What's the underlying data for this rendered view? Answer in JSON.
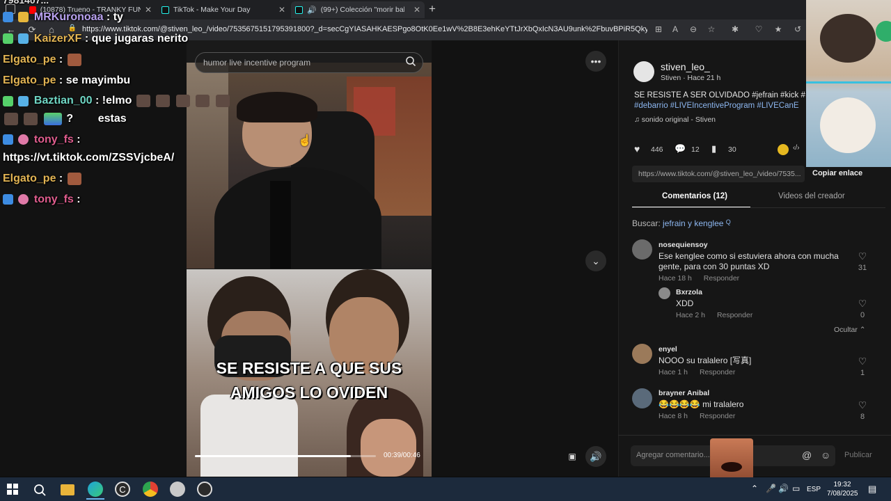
{
  "tabs": [
    {
      "label": "(10878) Trueno - TRANKY FUNKY",
      "favicon_color": "#ff0000"
    },
    {
      "label": "TikTok - Make Your Day",
      "favicon_color": "#25f4ee"
    },
    {
      "label": "(99+) Colección \"morir bale...",
      "favicon_color": "#25f4ee"
    }
  ],
  "new_tab_label": "+",
  "browser": {
    "url": "https://www.tiktok.com/@stiven_leo_/video/7535675151795391800?_d=secCgYIASAHKAESPgo8OtK0Ee1wV%2B8E3ehKeYTtJrXbQxIcN3AU9unk%2FbuvBPiR5Qky..."
  },
  "chat": {
    "top_fragment": "7981407...",
    "messages": [
      {
        "user": "MRKuronoaa",
        "text": ": ty",
        "user_color": "#b9a2f0"
      },
      {
        "user": "KaizerXF",
        "text": ": que jugaras nerito",
        "user_color": "#e2b453"
      },
      {
        "user": "Elgato_pe",
        "text": ":",
        "user_color": "#e2b453"
      },
      {
        "user": "Elgato_pe",
        "text": ": se mayimbu",
        "user_color": "#e2b453"
      },
      {
        "user": "Baztian_00",
        "text": ": !elmo",
        "user_color": "#6fd6c4"
      },
      {
        "user": "",
        "text": "?        estas",
        "user_color": "#ffffff"
      },
      {
        "user": "tony_fs",
        "text": ":",
        "user_color": "#e05d8e"
      },
      {
        "user": "",
        "text": "https://vt.tiktok.com/ZSSVjcbeA/",
        "user_color": "#ffffff"
      },
      {
        "user": "Elgato_pe",
        "text": ":",
        "user_color": "#e2b453"
      },
      {
        "user": "tony_fs",
        "text": ":",
        "user_color": "#e05d8e"
      }
    ]
  },
  "video": {
    "search_placeholder": "humor live incentive program",
    "caption_line1": "SE RESISTE A QUE SUS",
    "caption_line2": "AMIGOS LO OVIDEN",
    "timecode": "00:39/00:46",
    "progress": 0.86
  },
  "creator": {
    "handle": "stiven_leo_",
    "name_line": "Stiven · Hace 21 h",
    "description_line1": "SE RESISTE A SER OLVIDADO #jefrain #kick #",
    "description_line2": "#debarrio #LIVEIncentiveProgram #LIVECanE",
    "sound": "sonido original - Stiven",
    "likes": "446",
    "comments": "12",
    "saves": "30",
    "share_url": "https://www.tiktok.com/@stiven_leo_/video/7535...",
    "copy_link_label": "Copiar enlace"
  },
  "panel_tabs": {
    "comments": "Comentarios (12)",
    "creator_videos": "Videos del creador"
  },
  "search_suggestion": {
    "prefix": "Buscar:",
    "term": "jefrain y kenglee"
  },
  "comments": [
    {
      "user": "nosequiensoy",
      "text": "Ese kenglee como si estuviera ahora con mucha gente, para con 30 puntas XD",
      "time": "Hace 18 h",
      "reply": "Responder",
      "likes": "31"
    },
    {
      "user": "Bxrzola",
      "text": "XDD",
      "time": "Hace 2 h",
      "reply": "Responder",
      "likes": "0"
    },
    {
      "user": "enyel",
      "text": "NOOO su tralalero [写真]",
      "time": "Hace 1 h",
      "reply": "Responder",
      "likes": "1"
    },
    {
      "user": "brayner Anibal",
      "text": "😂😂😂😂 mi tralalero",
      "time": "Hace 8 h",
      "reply": "Responder",
      "likes": "8"
    }
  ],
  "hide_label": "Ocultar",
  "add_comment_placeholder": "Agregar comentario...",
  "publish_label": "Publicar",
  "taskbar": {
    "language": "ESP",
    "time": "19:32",
    "date": "7/08/2025"
  }
}
